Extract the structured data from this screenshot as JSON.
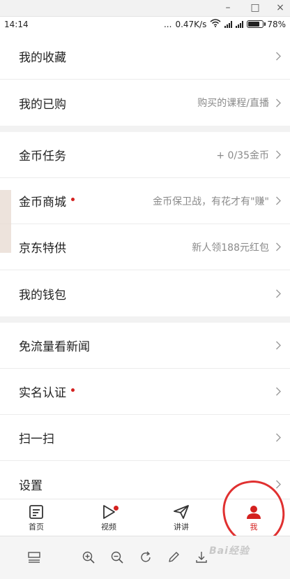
{
  "window_controls": {
    "minimize": "–",
    "maximize": "□",
    "close": "×"
  },
  "status_bar": {
    "time": "14:14",
    "dots": "...",
    "speed": "0.47K/s",
    "battery": "78%",
    "battery_level": 0.78
  },
  "menu": {
    "group1": [
      {
        "label": "我的收藏",
        "sub": "",
        "dot": false
      },
      {
        "label": "我的已购",
        "sub": "购买的课程/直播",
        "dot": false
      }
    ],
    "group2": [
      {
        "label": "金币任务",
        "sub": "+ 0/35金币",
        "dot": false
      },
      {
        "label": "金币商城",
        "sub": "金币保卫战，有花才有\"赚\"",
        "dot": true
      },
      {
        "label": "京东特供",
        "sub": "新人领188元红包",
        "dot": false
      },
      {
        "label": "我的钱包",
        "sub": "",
        "dot": false
      }
    ],
    "group3": [
      {
        "label": "免流量看新闻",
        "sub": "",
        "dot": false
      },
      {
        "label": "实名认证",
        "sub": "",
        "dot": true
      },
      {
        "label": "扫一扫",
        "sub": "",
        "dot": false
      },
      {
        "label": "设置",
        "sub": "",
        "dot": false
      }
    ]
  },
  "tabbar": {
    "tabs": [
      {
        "label": "首页",
        "icon": "home-icon"
      },
      {
        "label": "视频",
        "icon": "play-icon"
      },
      {
        "label": "讲讲",
        "icon": "paper-plane-icon"
      },
      {
        "label": "我",
        "icon": "user-icon"
      }
    ],
    "active_index": 3
  },
  "watermark": "Bai经验",
  "colors": {
    "accent": "#d4211f",
    "annotation": "#e03030",
    "muted": "#8a8a8a"
  }
}
